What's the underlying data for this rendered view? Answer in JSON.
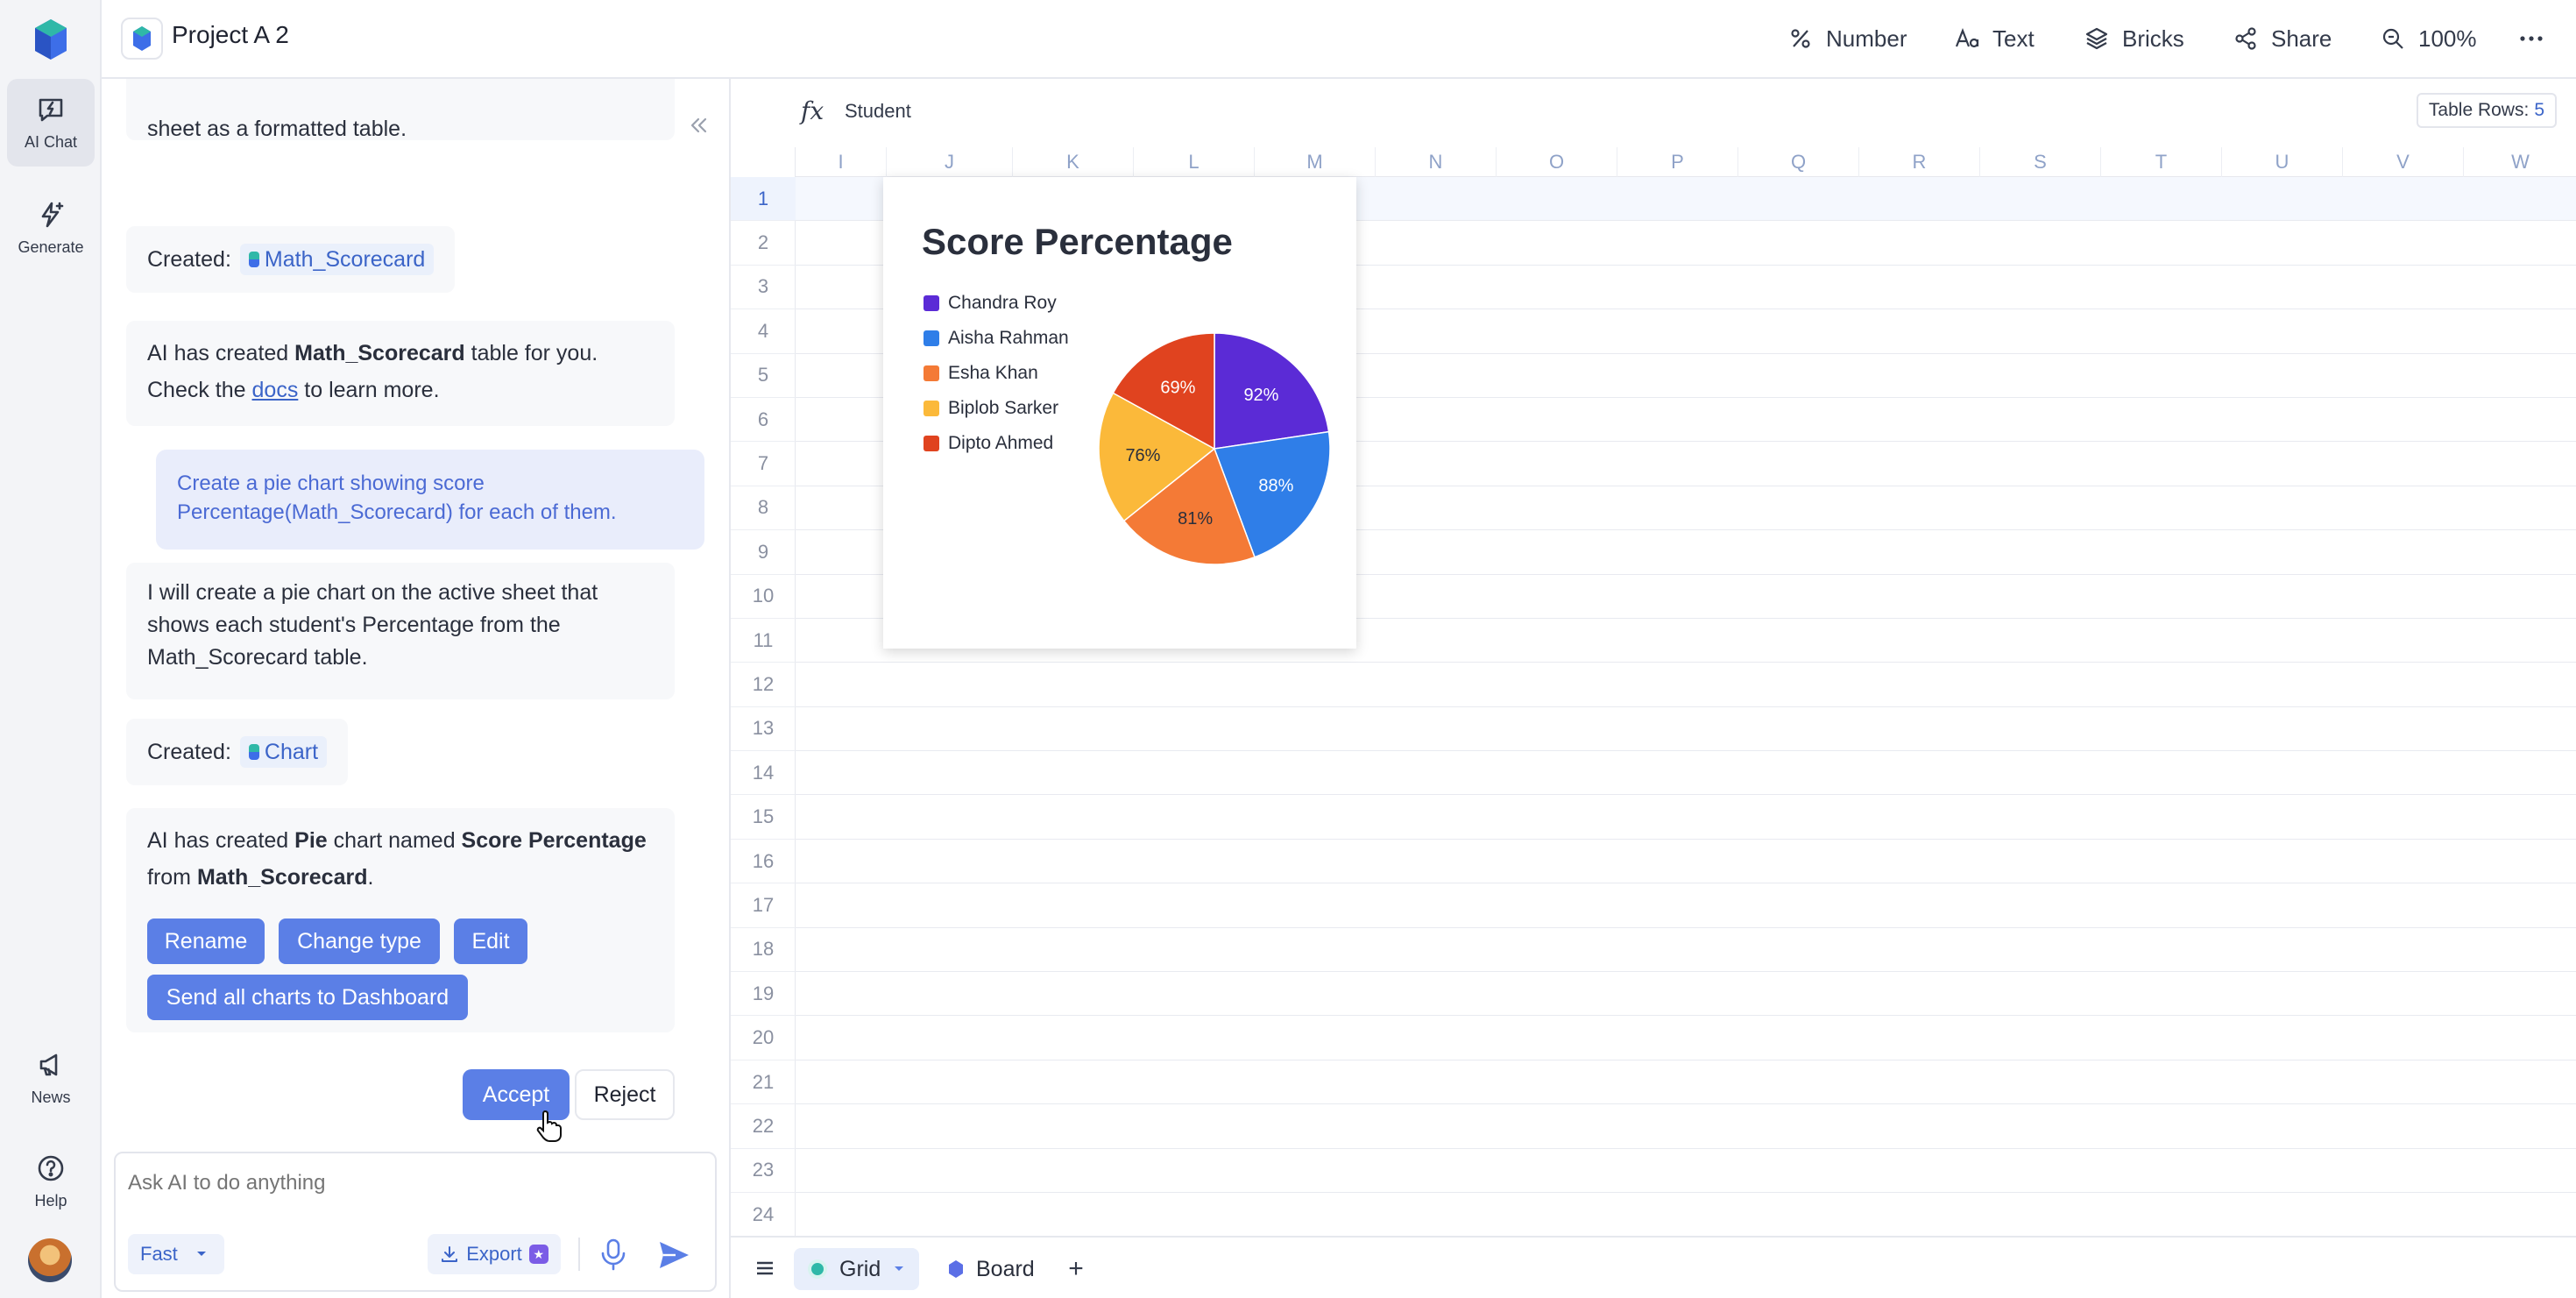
{
  "rail": {
    "items": [
      {
        "label": "AI Chat"
      },
      {
        "label": "Generate"
      },
      {
        "label": "News"
      },
      {
        "label": "Help"
      }
    ]
  },
  "header": {
    "title": "Project A 2",
    "buttons": [
      {
        "label": "Number",
        "icon": "percent-icon"
      },
      {
        "label": "Text",
        "icon": "text-format-icon"
      },
      {
        "label": "Bricks",
        "icon": "layers-icon"
      },
      {
        "label": "Share",
        "icon": "share-icon"
      },
      {
        "label": "100%",
        "icon": "zoom-icon"
      }
    ]
  },
  "chat": {
    "msg1_text": "sheet as a formatted table.",
    "created_label": "Created:",
    "chip1": "Math_Scorecard",
    "msg3": {
      "pre": "AI has created ",
      "bold": "Math_Scorecard",
      "post": " table for you.",
      "line2_pre": "Check the ",
      "link": "docs",
      "line2_post": " to learn more."
    },
    "user_msg": "Create a pie chart showing score Percentage(Math_Scorecard) for each of them.",
    "msg4": "I will create a pie chart on the active sheet that shows each student's Percentage from the Math_Scorecard table.",
    "chip2": "Chart",
    "msg5": {
      "p1": "AI has created ",
      "b1": "Pie",
      "p2": " chart named ",
      "b2": "Score Percentage",
      "p3": "from ",
      "b3": "Math_Scorecard",
      "p4": "."
    },
    "actions": [
      "Rename",
      "Change type",
      "Edit"
    ],
    "send_all": "Send all charts to Dashboard",
    "accept": "Accept",
    "reject": "Reject",
    "input_placeholder": "Ask AI to do anything",
    "mode": "Fast",
    "export": "Export"
  },
  "sheet": {
    "formula_value": "Student",
    "rows_label": "Table Rows:",
    "rows_count": "5",
    "columns": [
      "I",
      "J",
      "K",
      "L",
      "M",
      "N",
      "O",
      "P",
      "Q",
      "R",
      "S",
      "T",
      "U",
      "V",
      "W"
    ],
    "rows": [
      "1",
      "2",
      "3",
      "4",
      "5",
      "6",
      "7",
      "8",
      "9",
      "10",
      "11",
      "12",
      "13",
      "14",
      "15",
      "16",
      "17",
      "18",
      "19",
      "20",
      "21",
      "22",
      "23",
      "24"
    ]
  },
  "chart_data": {
    "type": "pie",
    "title": "Score Percentage",
    "legend_position": "left",
    "categories": [
      "Chandra Roy",
      "Aisha Rahman",
      "Esha Khan",
      "Biplob Sarker",
      "Dipto Ahmed"
    ],
    "values": [
      92,
      88,
      81,
      76,
      69
    ],
    "labels": [
      "92%",
      "88%",
      "81%",
      "76%",
      "69%"
    ],
    "colors": [
      "#5b2bd6",
      "#2f7ee8",
      "#f47a36",
      "#fbb93a",
      "#e0431f"
    ]
  },
  "tabs": {
    "items": [
      {
        "label": "Grid"
      },
      {
        "label": "Board"
      }
    ]
  }
}
